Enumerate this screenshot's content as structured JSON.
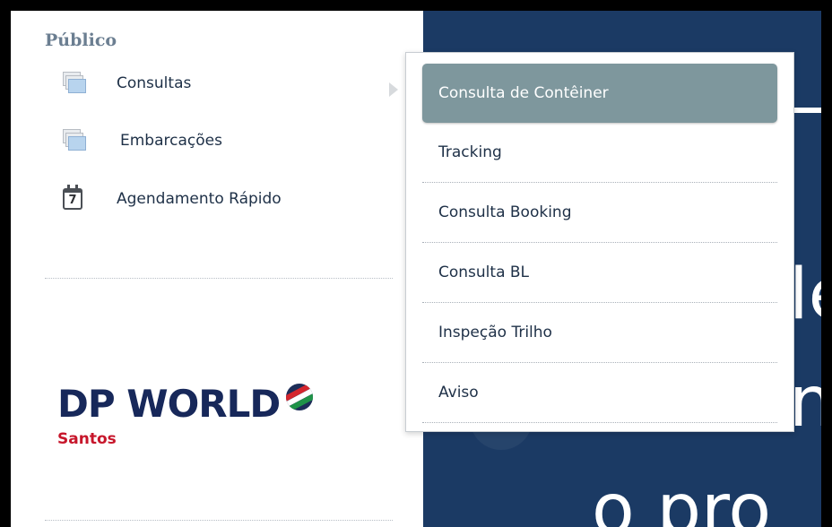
{
  "section": {
    "title": "Público"
  },
  "nav": {
    "items": [
      {
        "label": "Consultas",
        "icon": "stacked-pages-icon"
      },
      {
        "label": "Embarcações",
        "icon": "stacked-pages-icon"
      },
      {
        "label": "Agendamento Rápido",
        "icon": "calendar-icon",
        "icon_text": "7"
      }
    ]
  },
  "submenu": {
    "items": [
      {
        "label": "Consulta de Contêiner",
        "active": true
      },
      {
        "label": "Tracking"
      },
      {
        "label": "Consulta Booking"
      },
      {
        "label": "Consulta BL"
      },
      {
        "label": "Inspeção Trilho"
      },
      {
        "label": "Aviso"
      }
    ]
  },
  "logo": {
    "main": "DP WORLD",
    "sub": "Santos"
  },
  "background_text": {
    "line1": "le",
    "line2": "n",
    "line3": "o pro"
  },
  "colors": {
    "navy": "#1b3a64",
    "active_item": "#7e979d",
    "logo_blue": "#17285a",
    "logo_red": "#c7162b"
  }
}
